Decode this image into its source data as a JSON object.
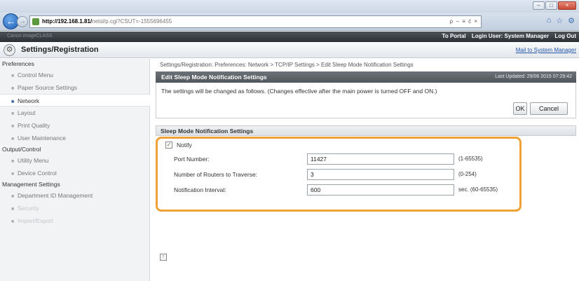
{
  "browser": {
    "url_host": "http://192.168.1.81/",
    "url_path": "netsl/p.cgi?CSUT=-1555696455",
    "addr_tools": "ρ − ≡ ć ×",
    "window_controls": [
      "–",
      "□",
      "×"
    ]
  },
  "canon_bar": {
    "left_text": "Canon imageCLASS",
    "portal_link": "To Portal",
    "login_label": "Login User: System Manager",
    "logout_link": "Log Out"
  },
  "header": {
    "title": "Settings/Registration",
    "mail_link": "Mail to System Manager"
  },
  "sidebar": {
    "groups": [
      {
        "label": "Preferences",
        "items": [
          {
            "label": "Control Menu",
            "active": false
          },
          {
            "label": "Paper Source Settings",
            "active": false
          },
          {
            "label": "Network",
            "active": true
          },
          {
            "label": "Layout",
            "active": false
          },
          {
            "label": "Print Quality",
            "active": false
          },
          {
            "label": "User Maintenance",
            "active": false
          }
        ]
      },
      {
        "label": "Output/Control",
        "items": [
          {
            "label": "Utility Menu",
            "active": false
          },
          {
            "label": "Device Control",
            "active": false
          }
        ]
      },
      {
        "label": "Management Settings",
        "items": [
          {
            "label": "Department ID Management",
            "active": false
          },
          {
            "label": "Security",
            "active": false
          },
          {
            "label": "Import/Export",
            "active": false
          }
        ]
      }
    ]
  },
  "main": {
    "breadcrumb": "Settings/Registration: Preferences: Network > TCP/IP Settings > Edit Sleep Mode Notification Settings",
    "panel": {
      "title": "Edit Sleep Mode Notification Settings",
      "last_updated": "Last Updated: 29/06 2015 07:29:42",
      "message": "The settings will be changed as follows. (Changes effective after the main power is turned OFF and ON.)",
      "ok_label": "OK",
      "cancel_label": "Cancel"
    },
    "section": {
      "title": "Sleep Mode Notification Settings",
      "notify_label": "Notify",
      "notify_checked": "✓",
      "fields": [
        {
          "label": "Port Number:",
          "value": "11427",
          "range": "(1-65535)"
        },
        {
          "label": "Number of Routers to Traverse:",
          "value": "3",
          "range": "(0-254)"
        },
        {
          "label": "Notification Interval:",
          "value": "600",
          "range": "sec. (60-65535)"
        }
      ]
    },
    "top_icon": "↑"
  },
  "colors": {
    "highlight": "#f0a23a",
    "panel_header": "#5a6065",
    "active_bullet": "#2a5caa"
  }
}
